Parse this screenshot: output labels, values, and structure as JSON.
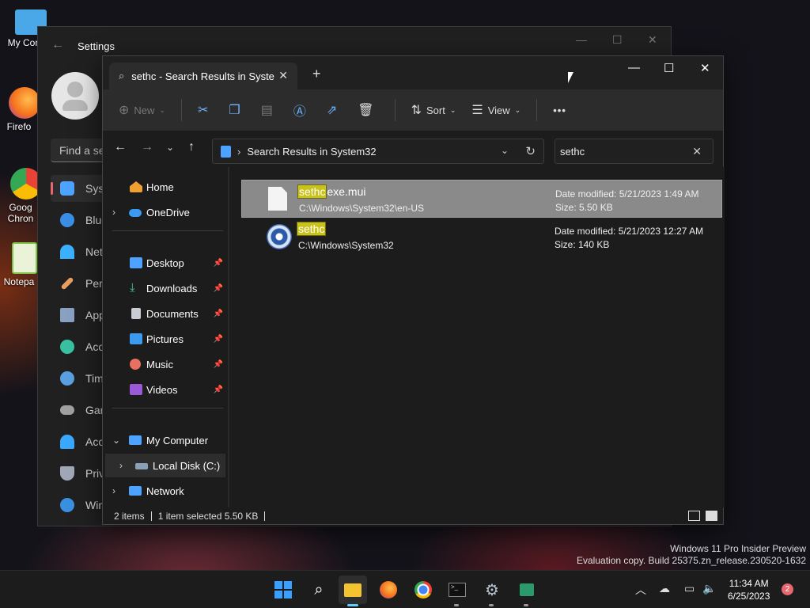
{
  "desktop": {
    "icons": [
      {
        "label": "My Com",
        "color": "#4aa8e8"
      },
      {
        "label": "Firefo",
        "color": "#f5731c"
      },
      {
        "label": "Goog Chron",
        "color": "#4285f4"
      },
      {
        "label": "Notepa",
        "color": "#7cc247"
      }
    ],
    "watermark": {
      "line1": "Windows 11 Pro Insider Preview",
      "line2": "Evaluation copy. Build 25375.zn_release.230520-1632"
    }
  },
  "settings": {
    "title": "Settings",
    "search_placeholder": "Find a se",
    "nav": [
      {
        "label": "Syst",
        "icon": "display-icon",
        "color": "#4da3ff"
      },
      {
        "label": "Blue",
        "icon": "bluetooth-icon",
        "color": "#3a8ee6"
      },
      {
        "label": "Net",
        "icon": "wifi-icon",
        "color": "#3ab0ff"
      },
      {
        "label": "Pers",
        "icon": "brush-icon",
        "color": "#e8a060"
      },
      {
        "label": "App",
        "icon": "apps-icon",
        "color": "#8aa0c0"
      },
      {
        "label": "Acc",
        "icon": "person-icon",
        "color": "#38c0a0"
      },
      {
        "label": "Tim",
        "icon": "clock-icon",
        "color": "#5aa0e0"
      },
      {
        "label": "Gar",
        "icon": "gamepad-icon",
        "color": "#a0a0a0"
      },
      {
        "label": "Acc",
        "icon": "accessibility-icon",
        "color": "#3aa8ff"
      },
      {
        "label": "Priv",
        "icon": "shield-icon",
        "color": "#a0a8b8"
      },
      {
        "label": "Win",
        "icon": "update-icon",
        "color": "#3a90e0"
      }
    ]
  },
  "explorer": {
    "tab_title": "sethc - Search Results in Syste",
    "toolbar": {
      "new_label": "New",
      "sort_label": "Sort",
      "view_label": "View",
      "more_label": "•••"
    },
    "address": {
      "path": "Search Results in System32"
    },
    "search": {
      "value": "sethc"
    },
    "nav": {
      "home": "Home",
      "onedrive": "OneDrive",
      "desktop": "Desktop",
      "downloads": "Downloads",
      "documents": "Documents",
      "pictures": "Pictures",
      "music": "Music",
      "videos": "Videos",
      "my_computer": "My Computer",
      "local_disk": "Local Disk (C:)",
      "network": "Network"
    },
    "files": [
      {
        "name_highlight": "sethc",
        "name_rest": "exe.mui",
        "path": "C:\\Windows\\System32\\en-US",
        "date_modified": "Date modified:  5/21/2023 1:49 AM",
        "size": "Size:  5.50 KB",
        "selected": true
      },
      {
        "name_highlight": "sethc",
        "name_rest": "",
        "path": "C:\\Windows\\System32",
        "date_modified": "Date modified:  5/21/2023 12:27 AM",
        "size": "Size:  140 KB",
        "selected": false
      }
    ],
    "status": {
      "count": "2 items",
      "selection": "1 item selected  5.50 KB"
    }
  },
  "taskbar": {
    "time": "11:34 AM",
    "date": "6/25/2023",
    "notification_count": "2"
  }
}
